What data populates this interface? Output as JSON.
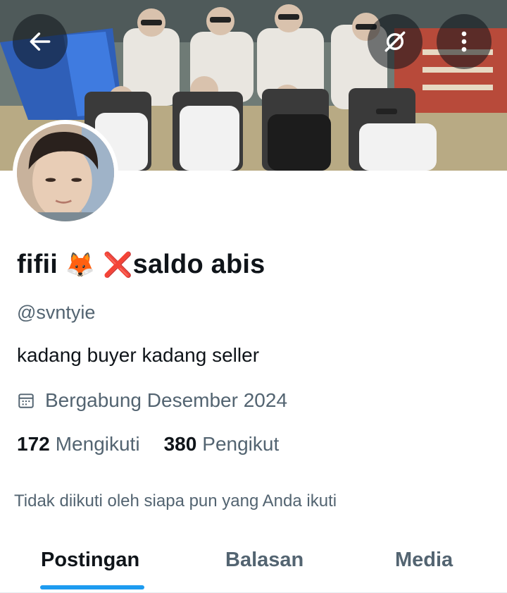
{
  "header": {
    "back_icon": "arrow-left-icon",
    "grok_icon": "grok-icon",
    "more_icon": "more-vertical-icon"
  },
  "profile": {
    "name_text": "fifii",
    "name_emoji_1": "🦊",
    "name_emoji_2": "❌",
    "name_suffix": "saldo abis",
    "handle": "@svntyie",
    "bio": "kadang buyer kadang seller",
    "joined_icon": "calendar-icon",
    "joined": "Bergabung Desember 2024",
    "following_count": "172",
    "following_label": "Mengikuti",
    "followers_count": "380",
    "followers_label": "Pengikut",
    "not_followed_text": "Tidak diikuti oleh siapa pun yang Anda ikuti"
  },
  "tabs": [
    {
      "label": "Postingan",
      "active": true
    },
    {
      "label": "Balasan",
      "active": false
    },
    {
      "label": "Media",
      "active": false
    }
  ],
  "colors": {
    "accent": "#1d9bf0",
    "text_primary": "#0f1419",
    "text_secondary": "#536471"
  }
}
